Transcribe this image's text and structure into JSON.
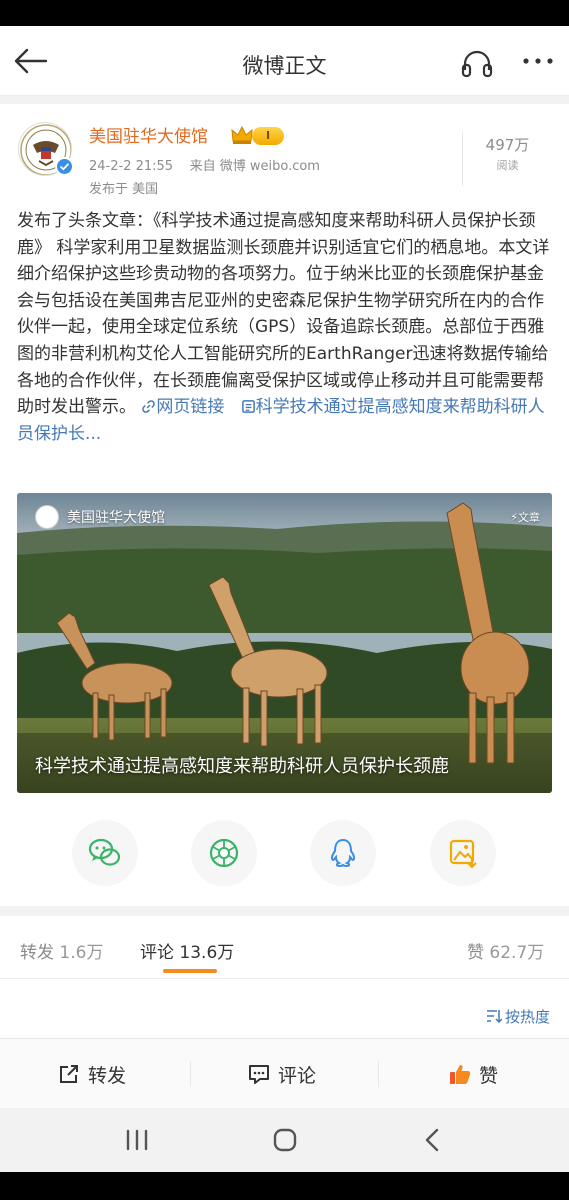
{
  "header": {
    "title": "微博正文"
  },
  "author": {
    "name": "美国驻华大使馆",
    "vip_level": "I",
    "timestamp": "24-2-2 21:55",
    "source": "来自 微博 weibo.com",
    "published_in": "发布于 美国",
    "reads_count": "497万",
    "reads_label": "阅读"
  },
  "post": {
    "text": "发布了头条文章：《科学技术通过提高感知度来帮助科研人员保护长颈鹿》 科学家利用卫星数据监测长颈鹿并识别适宜它们的栖息地。本文详细介绍保护这些珍贵动物的各项努力。位于纳米比亚的长颈鹿保护基金会与包括设在美国弗吉尼亚州的史密森尼保护生物学研究所在内的合作伙伴一起，使用全球定位系统（GPS）设备追踪长颈鹿。总部位于西雅图的非营利机构艾伦人工智能研究所的EarthRanger迅速将数据传输给各地的合作伙伴，在长颈鹿偏离受保护区域或停止移动并且可能需要帮助时发出警示。",
    "web_link_label": "网页链接",
    "article_link_label": "科学技术通过提高感知度来帮助科研人员保护长..."
  },
  "card": {
    "source": "美国驻华大使馆",
    "type_label": "文章",
    "caption": "科学技术通过提高感知度来帮助科研人员保护长颈鹿"
  },
  "tabs": [
    {
      "label": "转发",
      "count": "1.6万"
    },
    {
      "label": "评论",
      "count": "13.6万"
    },
    {
      "label": "赞",
      "count": "62.7万"
    }
  ],
  "sort_label": "按热度",
  "actions": {
    "repost": "转发",
    "comment": "评论",
    "like": "赞"
  },
  "colors": {
    "accent_orange": "#f78a1e",
    "link_blue": "#4679b8",
    "author_orange": "#e06b1f",
    "like_red": "#f2542d"
  }
}
